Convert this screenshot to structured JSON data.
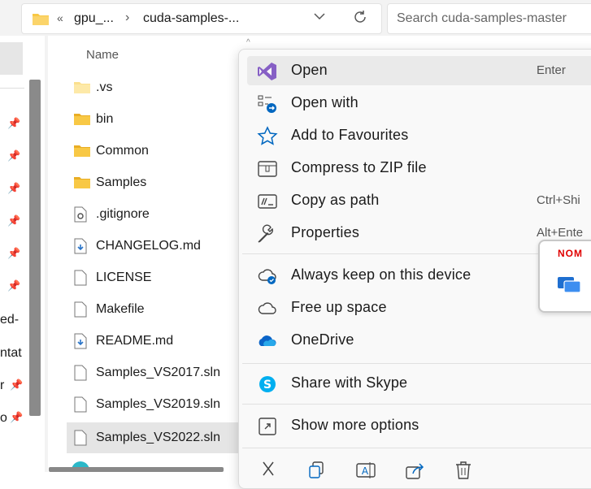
{
  "address_bar": {
    "seg1": "gpu_...",
    "seg2": "cuda-samples-...",
    "overflow": "«"
  },
  "search": {
    "placeholder": "Search cuda-samples-master"
  },
  "left_nav": {
    "labels": [
      "ed-",
      "ntat",
      "r",
      "o"
    ]
  },
  "file_list": {
    "column_name": "Name",
    "items": [
      {
        "name": ".vs",
        "type": "folder-light"
      },
      {
        "name": "bin",
        "type": "folder"
      },
      {
        "name": "Common",
        "type": "folder"
      },
      {
        "name": "Samples",
        "type": "folder"
      },
      {
        "name": ".gitignore",
        "type": "settings-file"
      },
      {
        "name": "CHANGELOG.md",
        "type": "md-file"
      },
      {
        "name": "LICENSE",
        "type": "file"
      },
      {
        "name": "Makefile",
        "type": "file"
      },
      {
        "name": "README.md",
        "type": "md-file"
      },
      {
        "name": "Samples_VS2017.sln",
        "type": "file"
      },
      {
        "name": "Samples_VS2019.sln",
        "type": "file"
      },
      {
        "name": "Samples_VS2022.sln",
        "type": "file",
        "selected": true
      }
    ]
  },
  "context_menu": {
    "items": [
      {
        "label": "Open",
        "shortcut": "Enter",
        "icon": "visual-studio-icon"
      },
      {
        "label": "Open with",
        "shortcut": "",
        "icon": "open-with-icon"
      },
      {
        "label": "Add to Favourites",
        "shortcut": "",
        "icon": "star-icon"
      },
      {
        "label": "Compress to ZIP file",
        "shortcut": "",
        "icon": "zip-icon"
      },
      {
        "label": "Copy as path",
        "shortcut": "Ctrl+Shi",
        "icon": "copy-path-icon"
      },
      {
        "label": "Properties",
        "shortcut": "Alt+Ente",
        "icon": "wrench-icon"
      },
      {
        "label": "Always keep on this device",
        "shortcut": "",
        "icon": "cloud-sync-icon"
      },
      {
        "label": "Free up space",
        "shortcut": "",
        "icon": "cloud-outline-icon"
      },
      {
        "label": "OneDrive",
        "shortcut": "",
        "icon": "onedrive-icon"
      },
      {
        "label": "Share with Skype",
        "shortcut": "",
        "icon": "skype-icon"
      },
      {
        "label": "Show more options",
        "shortcut": "",
        "icon": "expand-icon"
      }
    ],
    "bottom_actions": [
      "cut-icon",
      "copy-icon",
      "rename-icon",
      "share-icon",
      "delete-icon"
    ]
  },
  "popup": {
    "brand": "NOM"
  },
  "colors": {
    "accent": "#0067c0",
    "folder": "#f8c845",
    "vs_purple": "#865fc5",
    "onedrive": "#0a64c8",
    "skype": "#00aff0",
    "brand_red": "#e00000"
  }
}
